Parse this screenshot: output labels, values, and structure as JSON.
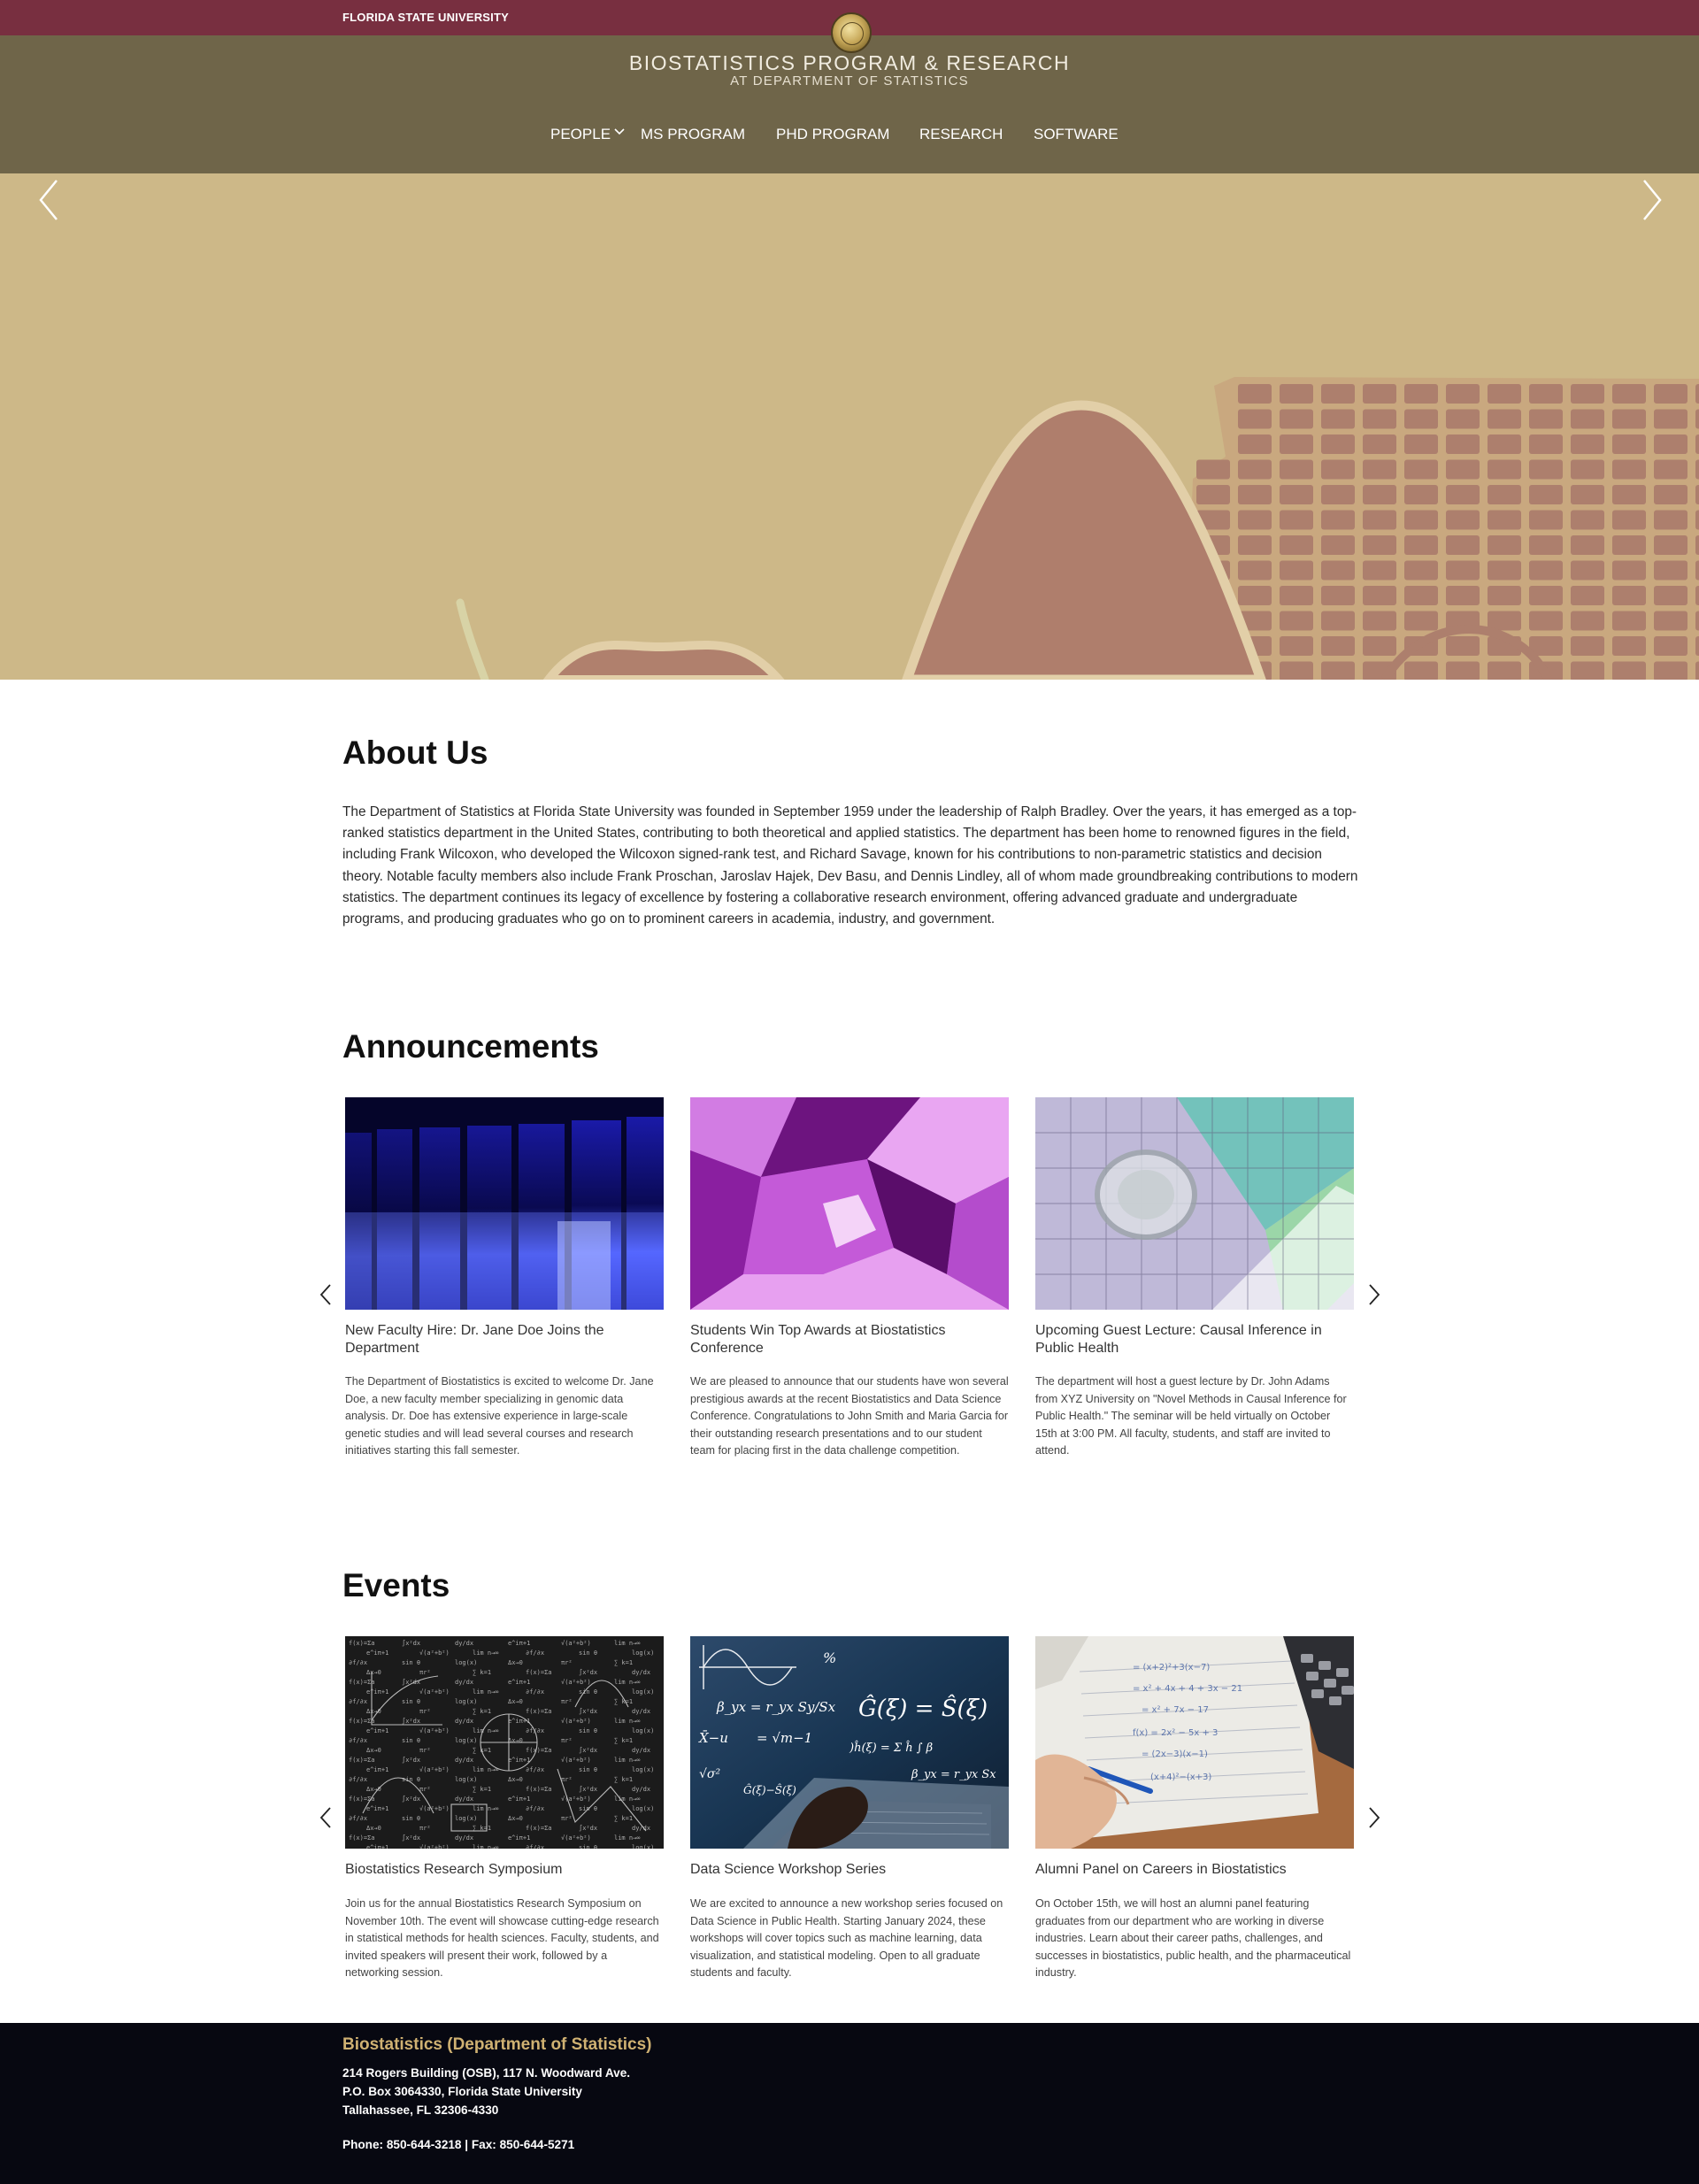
{
  "topbar": {
    "university": "FLORIDA STATE UNIVERSITY"
  },
  "header": {
    "title": "BIOSTATISTICS PROGRAM & RESEARCH",
    "subtitle": "AT DEPARTMENT OF STATISTICS",
    "nav": [
      {
        "label": "PEOPLE",
        "icon": "chevron-down-icon"
      },
      {
        "label": "MS PROGRAM"
      },
      {
        "label": "PHD PROGRAM"
      },
      {
        "label": "RESEARCH"
      },
      {
        "label": "SOFTWARE"
      }
    ]
  },
  "hero": {
    "prev_icon": "chevron-left-icon",
    "next_icon": "chevron-right-icon"
  },
  "about": {
    "heading": "About Us",
    "text": "The Department of Statistics at Florida State University was founded in September 1959 under the leadership of Ralph Bradley. Over the years, it has emerged as a top-ranked statistics department in the United States, contributing to both theoretical and applied statistics. The department has been home to renowned figures in the field, including Frank Wilcoxon, who developed the Wilcoxon signed-rank test, and Richard Savage, known for his contributions to non-parametric statistics and decision theory. Notable faculty members also include Frank Proschan, Jaroslav Hajek, Dev Basu, and Dennis Lindley, all of whom made groundbreaking contributions to modern statistics. The department continues its legacy of excellence by fostering a collaborative research environment, offering advanced graduate and undergraduate programs, and producing graduates who go on to prominent careers in academia, industry, and government."
  },
  "announcements": {
    "heading": "Announcements",
    "items": [
      {
        "title": "New Faculty Hire: Dr. Jane Doe Joins the Department",
        "body": "The Department of Biostatistics is excited to welcome Dr. Jane Doe, a new faculty member specializing in genomic data analysis. Dr. Doe has extensive experience in large-scale genetic studies and will lead several courses and research initiatives starting this fall semester."
      },
      {
        "title": "Students Win Top Awards at Biostatistics Conference",
        "body": "We are pleased to announce that our students have won several prestigious awards at the recent Biostatistics and Data Science Conference. Congratulations to John Smith and Maria Garcia for their outstanding research presentations and to our student team for placing first in the data challenge competition."
      },
      {
        "title": "Upcoming Guest Lecture: Causal Inference in Public Health",
        "body": "The department will host a guest lecture by Dr. John Adams from XYZ University on \"Novel Methods in Causal Inference for Public Health.\" The seminar will be held virtually on October 15th at 3:00 PM. All faculty, students, and staff are invited to attend."
      }
    ]
  },
  "events": {
    "heading": "Events",
    "items": [
      {
        "title": "Biostatistics Research Symposium",
        "body": "Join us for the annual Biostatistics Research Symposium on November 10th. The event will showcase cutting-edge research in statistical methods for health sciences. Faculty, students, and invited speakers will present their work, followed by a networking session."
      },
      {
        "title": "Data Science Workshop Series",
        "body": "We are excited to announce a new workshop series focused on Data Science in Public Health. Starting January 2024, these workshops will cover topics such as machine learning, data visualization, and statistical modeling. Open to all graduate students and faculty."
      },
      {
        "title": "Alumni Panel on Careers in Biostatistics",
        "body": "On October 15th, we will host an alumni panel featuring graduates from our department who are working in diverse industries. Learn about their career paths, challenges, and successes in biostatistics, public health, and the pharmaceutical industry."
      }
    ]
  },
  "footer": {
    "title": "Biostatistics (Department of Statistics)",
    "address1": "214 Rogers Building (OSB), 117 N. Woodward Ave.",
    "address2": "P.O. Box 3064330, Florida State University",
    "address3": "Tallahassee, FL 32306-4330",
    "phone": "Phone: 850-644-3218 | Fax: 850-644-5271"
  },
  "colors": {
    "topbar": "#782f40",
    "header": "#6f6549",
    "hero": "#cdb888",
    "footer": "#070811",
    "footer_title": "#cfb172"
  }
}
